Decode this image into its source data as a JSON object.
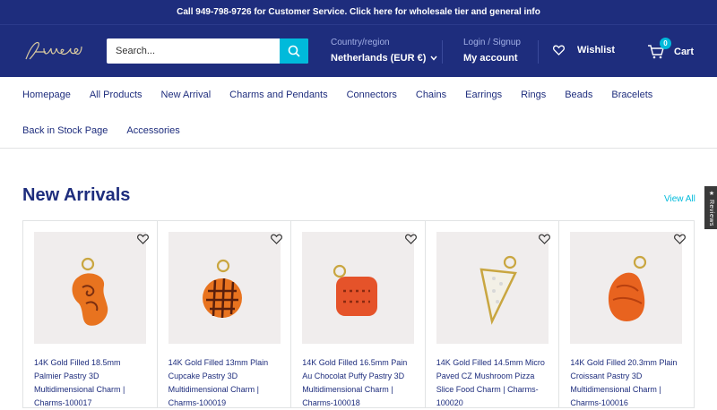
{
  "announcement": "Call 949-798-9726 for Customer Service. Click here for wholesale tier and general info",
  "search": {
    "placeholder": "Search..."
  },
  "region": {
    "label": "Country/region",
    "value": "Netherlands (EUR €)"
  },
  "account": {
    "label": "Login / Signup",
    "value": "My account"
  },
  "wishlist": {
    "label": "Wishlist"
  },
  "cart": {
    "label": "Cart",
    "count": "0"
  },
  "nav": {
    "row1": [
      "Homepage",
      "All Products",
      "New Arrival",
      "Charms and Pendants",
      "Connectors",
      "Chains",
      "Earrings",
      "Rings",
      "Beads",
      "Bracelets"
    ],
    "row2": [
      "Back in Stock Page",
      "Accessories"
    ]
  },
  "section": {
    "title": "New Arrivals",
    "view_all": "View All"
  },
  "reviews_tab": "★ Reviews",
  "products": [
    {
      "title": "14K Gold Filled 18.5mm Palmier Pastry 3D Multidimensional Charm | Charms-100017",
      "icon": "palmier-charm"
    },
    {
      "title": "14K Gold Filled 13mm Plain Cupcake Pastry 3D Multidimensional Charm | Charms-100019",
      "icon": "cupcake-charm"
    },
    {
      "title": "14K Gold Filled 16.5mm Pain Au Chocolat Puffy Pastry 3D Multidimensional Charm | Charms-100018",
      "icon": "pain-au-chocolat-charm"
    },
    {
      "title": "14K Gold Filled 14.5mm Micro Paved CZ Mushroom Pizza Slice Food Charm | Charms-100020",
      "icon": "pizza-slice-charm"
    },
    {
      "title": "14K Gold Filled 20.3mm Plain Croissant Pastry 3D Multidimensional Charm | Charms-100016",
      "icon": "croissant-charm"
    }
  ]
}
